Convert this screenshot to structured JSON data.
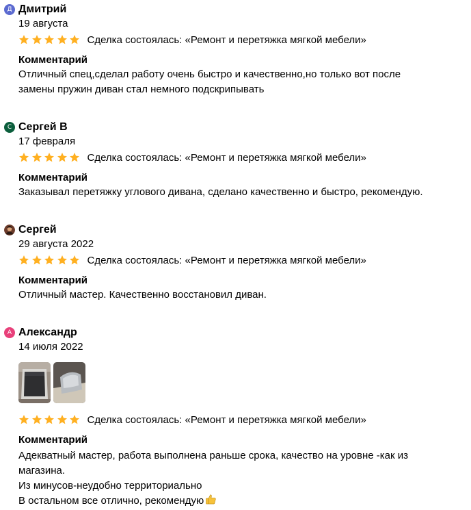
{
  "reviews": [
    {
      "author": "Дмитрий",
      "avatar_letter": "Д",
      "avatar_color": "#5b6ad0",
      "date": "19 августа",
      "rating": 5,
      "deal": "Сделка состоялась: «Ремонт и перетяжка мягкой мебели»",
      "comment_title": "Комментарий",
      "comment_lines": [
        "Отличный спец,сделал работу очень быстро и качественно,но только вот после",
        "замены пружин диван стал немного подскрипывать"
      ]
    },
    {
      "author": "Сергей В",
      "avatar_letter": "С",
      "avatar_color": "#0b5e3c",
      "date": "17 февраля",
      "rating": 5,
      "deal": "Сделка состоялась: «Ремонт и перетяжка мягкой мебели»",
      "comment_title": "Комментарий",
      "comment_lines": [
        "Заказывал перетяжку углового дивана, сделано качественно и быстро, рекомендую."
      ]
    },
    {
      "author": "Сергей",
      "avatar_letter": "",
      "avatar_color": "#6b3b2a",
      "date": "29 августа 2022",
      "rating": 5,
      "deal": "Сделка состоялась: «Ремонт и перетяжка мягкой мебели»",
      "comment_title": "Комментарий",
      "comment_lines": [
        "Отличный мастер. Качественно восстановил диван."
      ]
    },
    {
      "author": "Александр",
      "avatar_letter": "А",
      "avatar_color": "#e8407a",
      "date": "14 июля 2022",
      "rating": 5,
      "deal": "Сделка состоялась: «Ремонт и перетяжка мягкой мебели»",
      "comment_title": "Комментарий",
      "comment_lines": [
        "Адекватный мастер, работа выполнена раньше срока, качество на уровне -как из",
        "магазина.",
        "Из минусов-неудобно территориально",
        "В остальном все отлично, рекомендую"
      ],
      "photos_count": 2
    }
  ],
  "colors": {
    "star": "#ffb021"
  },
  "icons": {
    "star": "star-icon",
    "thumbs_up": "thumbs-up-icon"
  }
}
